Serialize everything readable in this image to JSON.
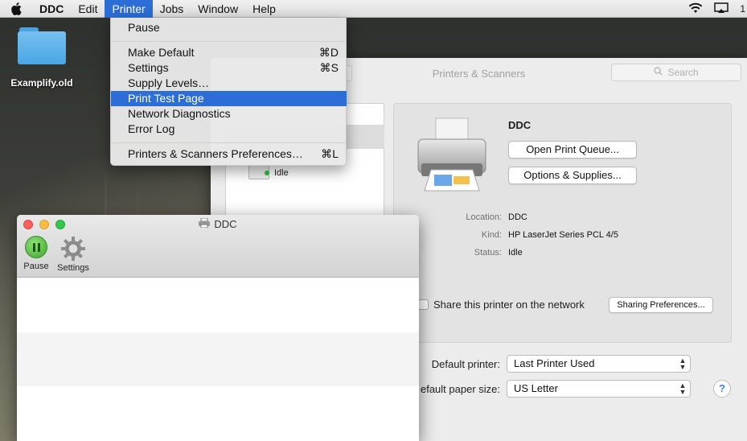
{
  "menubar": {
    "app_name": "DDC",
    "items": [
      "Edit",
      "Printer",
      "Jobs",
      "Window",
      "Help"
    ],
    "active_item": "Printer",
    "clock_partial": "1"
  },
  "desktop": {
    "icons": [
      {
        "label": "Examplify.old",
        "icon": "folder-icon"
      }
    ]
  },
  "printer_menu": {
    "items": [
      {
        "label": "Pause",
        "shortcut": ""
      },
      {
        "label": "Make Default",
        "shortcut": "⌘D"
      },
      {
        "label": "Settings",
        "shortcut": "⌘S"
      },
      {
        "label": "Supply Levels…",
        "shortcut": ""
      },
      {
        "label": "Print Test Page",
        "shortcut": "",
        "highlighted": true
      },
      {
        "label": "Network Diagnostics",
        "shortcut": ""
      },
      {
        "label": "Error Log",
        "shortcut": ""
      },
      {
        "label": "Printers & Scanners Preferences…",
        "shortcut": "⌘L"
      }
    ]
  },
  "printers_scanners": {
    "title": "Printers & Scanners",
    "search_placeholder": "Search",
    "list": {
      "status": "Idle"
    },
    "detail": {
      "name": "DDC",
      "open_queue_label": "Open Print Queue...",
      "options_label": "Options & Supplies...",
      "location_label": "Location:",
      "location_value": "DDC",
      "kind_label": "Kind:",
      "kind_value": "HP LaserJet Series PCL 4/5",
      "status_label": "Status:",
      "status_value": "Idle",
      "share_label": "Share this printer on the network",
      "sharing_prefs_label": "Sharing Preferences..."
    },
    "default_printer_label": "Default printer:",
    "default_printer_value": "Last Printer Used",
    "paper_size_label": "efault paper size:",
    "paper_size_value": "US Letter",
    "help_label": "?"
  },
  "print_queue": {
    "title": "DDC",
    "pause_label": "Pause",
    "settings_label": "Settings"
  }
}
